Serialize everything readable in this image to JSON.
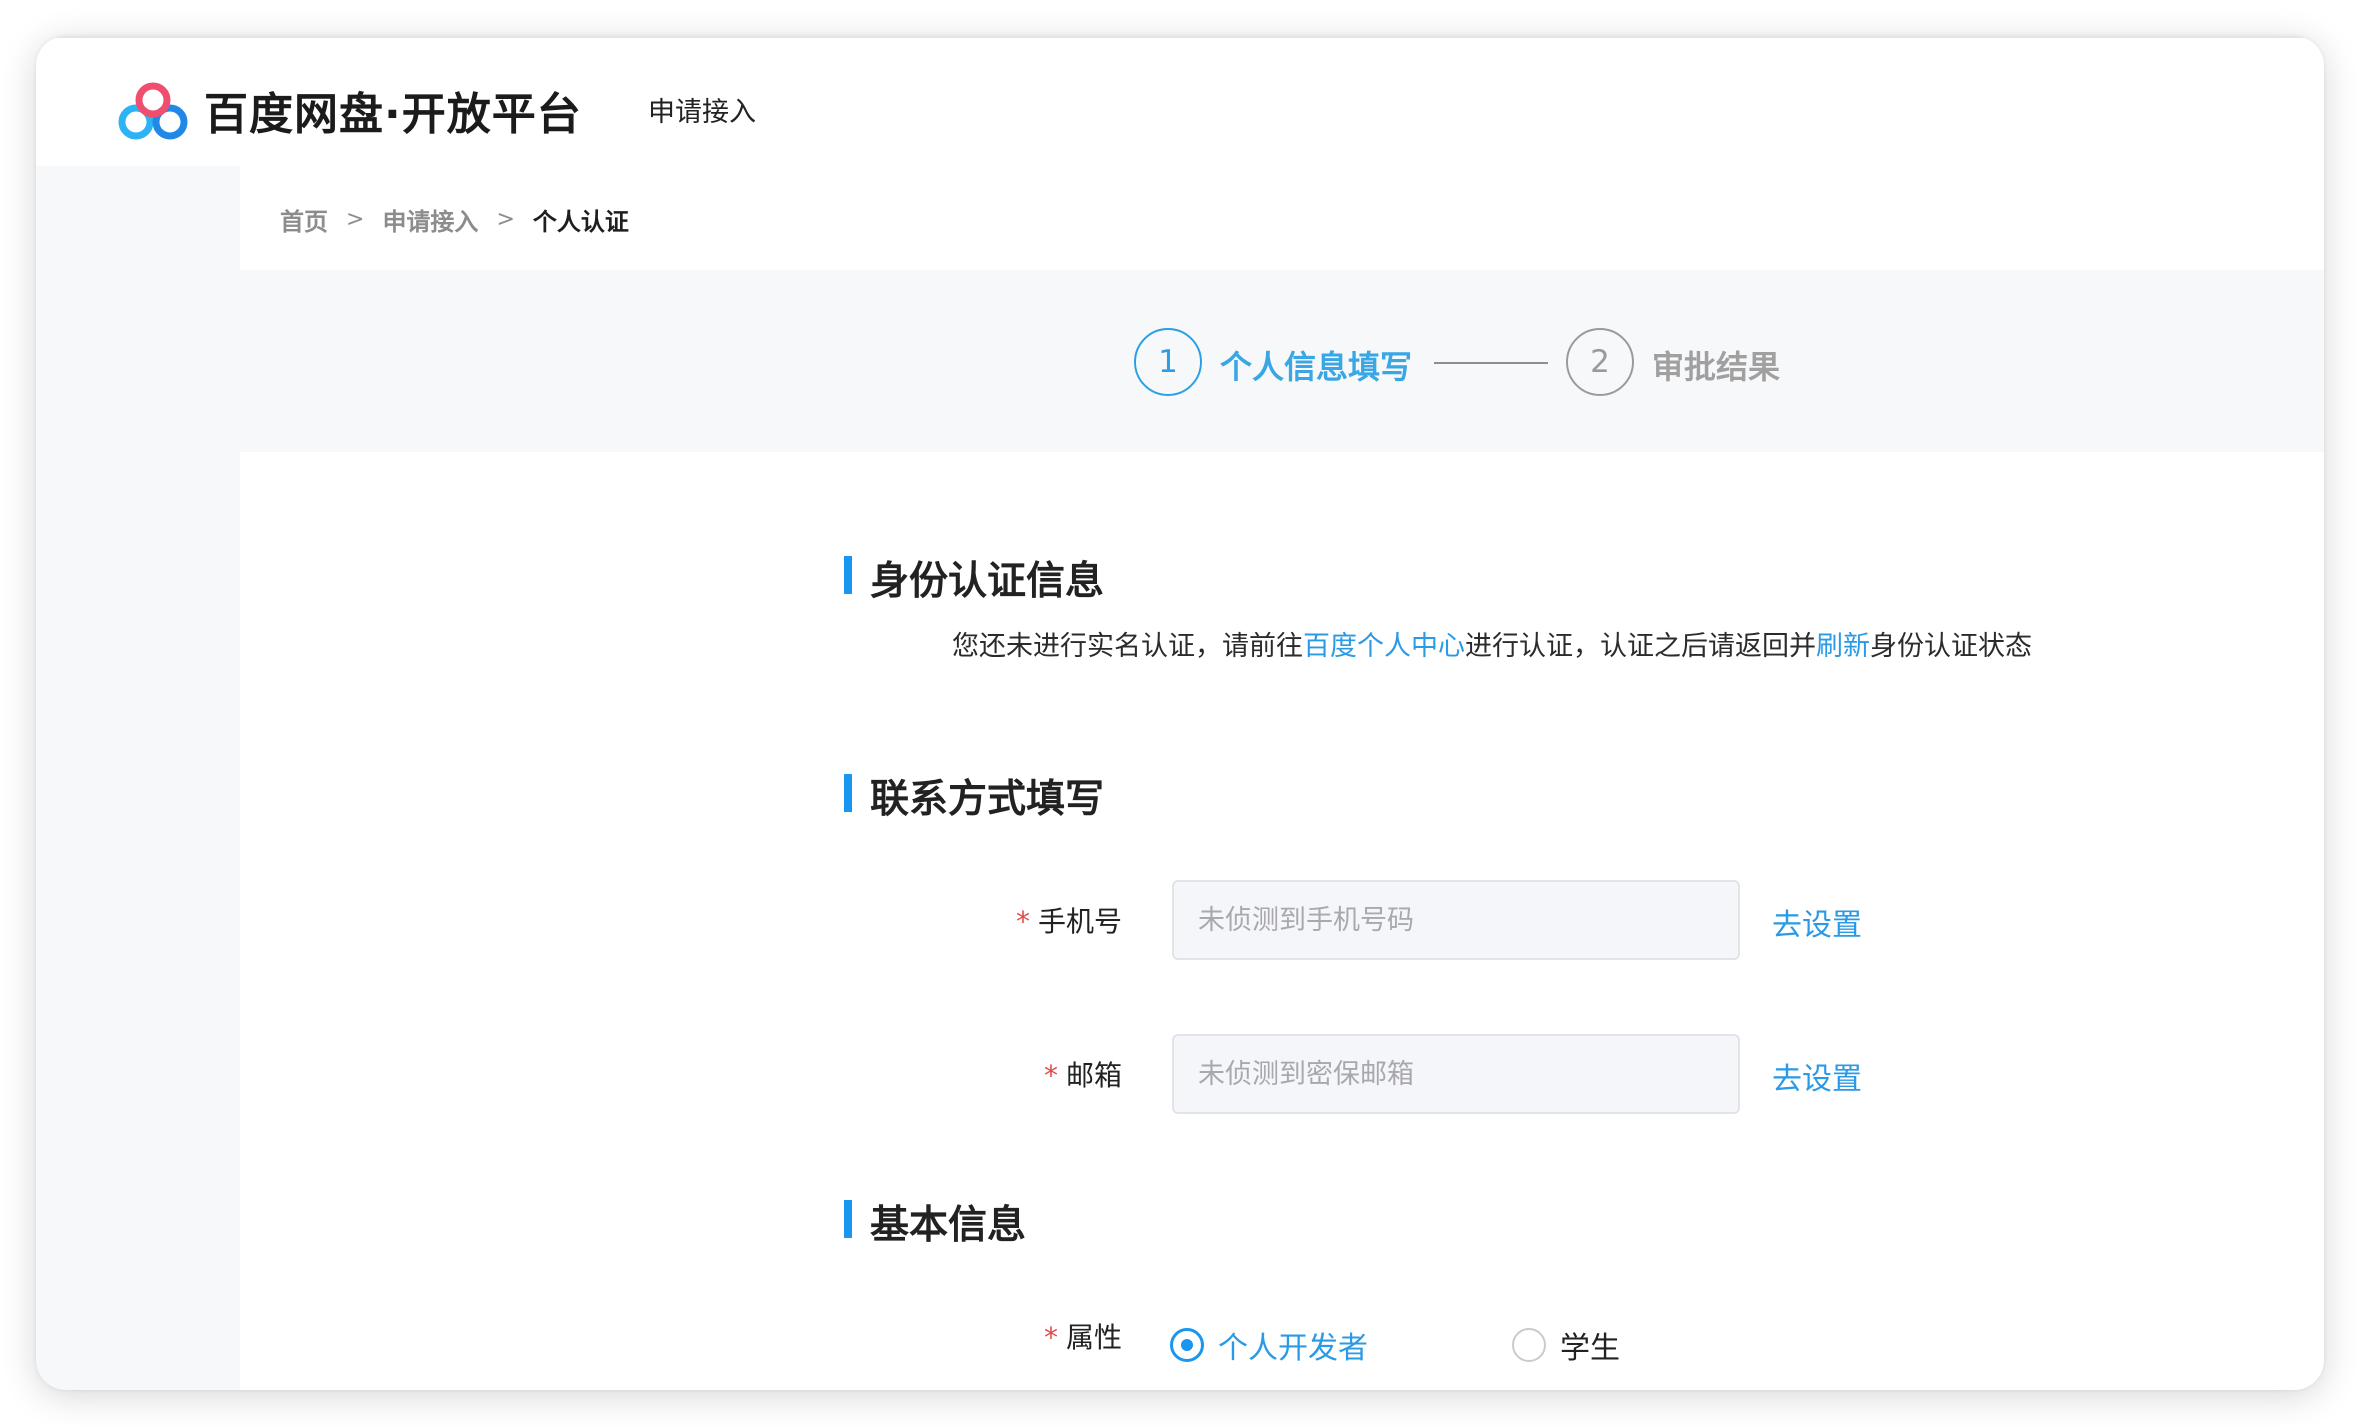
{
  "header": {
    "brand": "百度网盘·开放平台",
    "nav_apply": "申请接入"
  },
  "breadcrumb": {
    "home": "首页",
    "separator": ">",
    "apply": "申请接入",
    "current": "个人认证"
  },
  "steps": [
    {
      "number": "1",
      "label": "个人信息填写"
    },
    {
      "number": "2",
      "label": "审批结果"
    }
  ],
  "identity": {
    "title": "身份认证信息",
    "notice_prefix": "您还未进行实名认证，请前往",
    "notice_link_center": "百度个人中心",
    "notice_middle": "进行认证，认证之后请返回并",
    "notice_link_refresh": "刷新",
    "notice_suffix": "身份认证状态"
  },
  "contact": {
    "title": "联系方式填写",
    "phone_label": "手机号",
    "phone_value": "",
    "phone_placeholder": "未侦测到手机号码",
    "phone_set": "去设置",
    "email_label": "邮箱",
    "email_value": "",
    "email_placeholder": "未侦测到密保邮箱",
    "email_set": "去设置",
    "required_mark": "*"
  },
  "basic": {
    "title": "基本信息",
    "attribute_label": "属性",
    "required_mark": "*",
    "options": [
      {
        "label": "个人开发者",
        "checked": true
      },
      {
        "label": "学生",
        "checked": false
      }
    ]
  },
  "colors": {
    "accent": "#1a96f0",
    "link": "#2a9ae6",
    "required": "#e24a4a"
  }
}
